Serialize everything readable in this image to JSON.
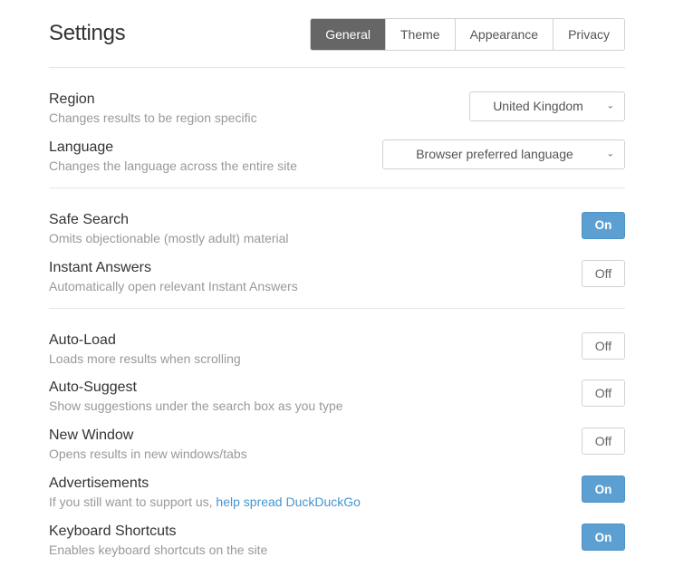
{
  "page_title": "Settings",
  "tabs": [
    {
      "label": "General",
      "active": true
    },
    {
      "label": "Theme",
      "active": false
    },
    {
      "label": "Appearance",
      "active": false
    },
    {
      "label": "Privacy",
      "active": false
    }
  ],
  "toggle_labels": {
    "on": "On",
    "off": "Off"
  },
  "groups": [
    {
      "rows": [
        {
          "title": "Region",
          "desc": "Changes results to be region specific",
          "control": {
            "type": "select",
            "size": "sm",
            "value": "United Kingdom"
          }
        },
        {
          "title": "Language",
          "desc": "Changes the language across the entire site",
          "control": {
            "type": "select",
            "size": "lg",
            "value": "Browser preferred language"
          }
        }
      ]
    },
    {
      "rows": [
        {
          "title": "Safe Search",
          "desc": "Omits objectionable (mostly adult) material",
          "control": {
            "type": "toggle",
            "state": "on"
          }
        },
        {
          "title": "Instant Answers",
          "desc": "Automatically open relevant Instant Answers",
          "control": {
            "type": "toggle",
            "state": "off"
          }
        }
      ]
    },
    {
      "rows": [
        {
          "title": "Auto-Load",
          "desc": "Loads more results when scrolling",
          "control": {
            "type": "toggle",
            "state": "off"
          }
        },
        {
          "title": "Auto-Suggest",
          "desc": "Show suggestions under the search box as you type",
          "control": {
            "type": "toggle",
            "state": "off"
          }
        },
        {
          "title": "New Window",
          "desc": "Opens results in new windows/tabs",
          "control": {
            "type": "toggle",
            "state": "off"
          }
        },
        {
          "title": "Advertisements",
          "desc_prefix": "If you still want to support us, ",
          "desc_link": "help spread DuckDuckGo",
          "control": {
            "type": "toggle",
            "state": "on"
          }
        },
        {
          "title": "Keyboard Shortcuts",
          "desc": "Enables keyboard shortcuts on the site",
          "control": {
            "type": "toggle",
            "state": "on"
          }
        }
      ]
    }
  ]
}
